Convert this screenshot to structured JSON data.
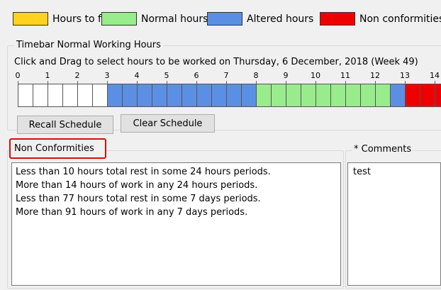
{
  "legend": [
    {
      "label": "Hours to fill",
      "color": "#ffd21f"
    },
    {
      "label": "Normal hours",
      "color": "#98ec8c"
    },
    {
      "label": "Altered hours",
      "color": "#5b8fe3"
    },
    {
      "label": "Non conformities",
      "color": "#ef0000"
    }
  ],
  "timebar": {
    "title": "Timebar Normal Working Hours",
    "instruction": "Click and Drag to select hours to be worked on Thursday, 6 December, 2018  (Week 49)",
    "hour_labels": [
      "0",
      "1",
      "2",
      "3",
      "4",
      "5",
      "6",
      "7",
      "8",
      "9",
      "10",
      "11",
      "12",
      "13",
      "14"
    ],
    "cell_states": [
      "empty",
      "empty",
      "empty",
      "empty",
      "empty",
      "empty",
      "altered",
      "altered",
      "altered",
      "altered",
      "altered",
      "altered",
      "altered",
      "altered",
      "altered",
      "altered",
      "normal",
      "normal",
      "normal",
      "normal",
      "normal",
      "normal",
      "normal",
      "normal",
      "normal",
      "altered",
      "nonconf",
      "nonconf",
      "nonconf"
    ],
    "colors": {
      "empty": "#ffffff",
      "normal": "#98ec8c",
      "altered": "#5b8fe3",
      "nonconf": "#ef0000"
    }
  },
  "buttons": {
    "recall_label": "Recall Schedule",
    "clear_label": "Clear Schedule"
  },
  "nonconformities": {
    "title": "Non Conformities",
    "lines": [
      "Less than 10 hours total rest in some 24 hours periods.",
      "More than 14 hours of work in any 24 hours periods.",
      "Less than 77 hours total rest in some 7 days periods.",
      "More than 91 hours of work in any 7 days periods."
    ]
  },
  "comments": {
    "title": "* Comments",
    "value": "test"
  }
}
